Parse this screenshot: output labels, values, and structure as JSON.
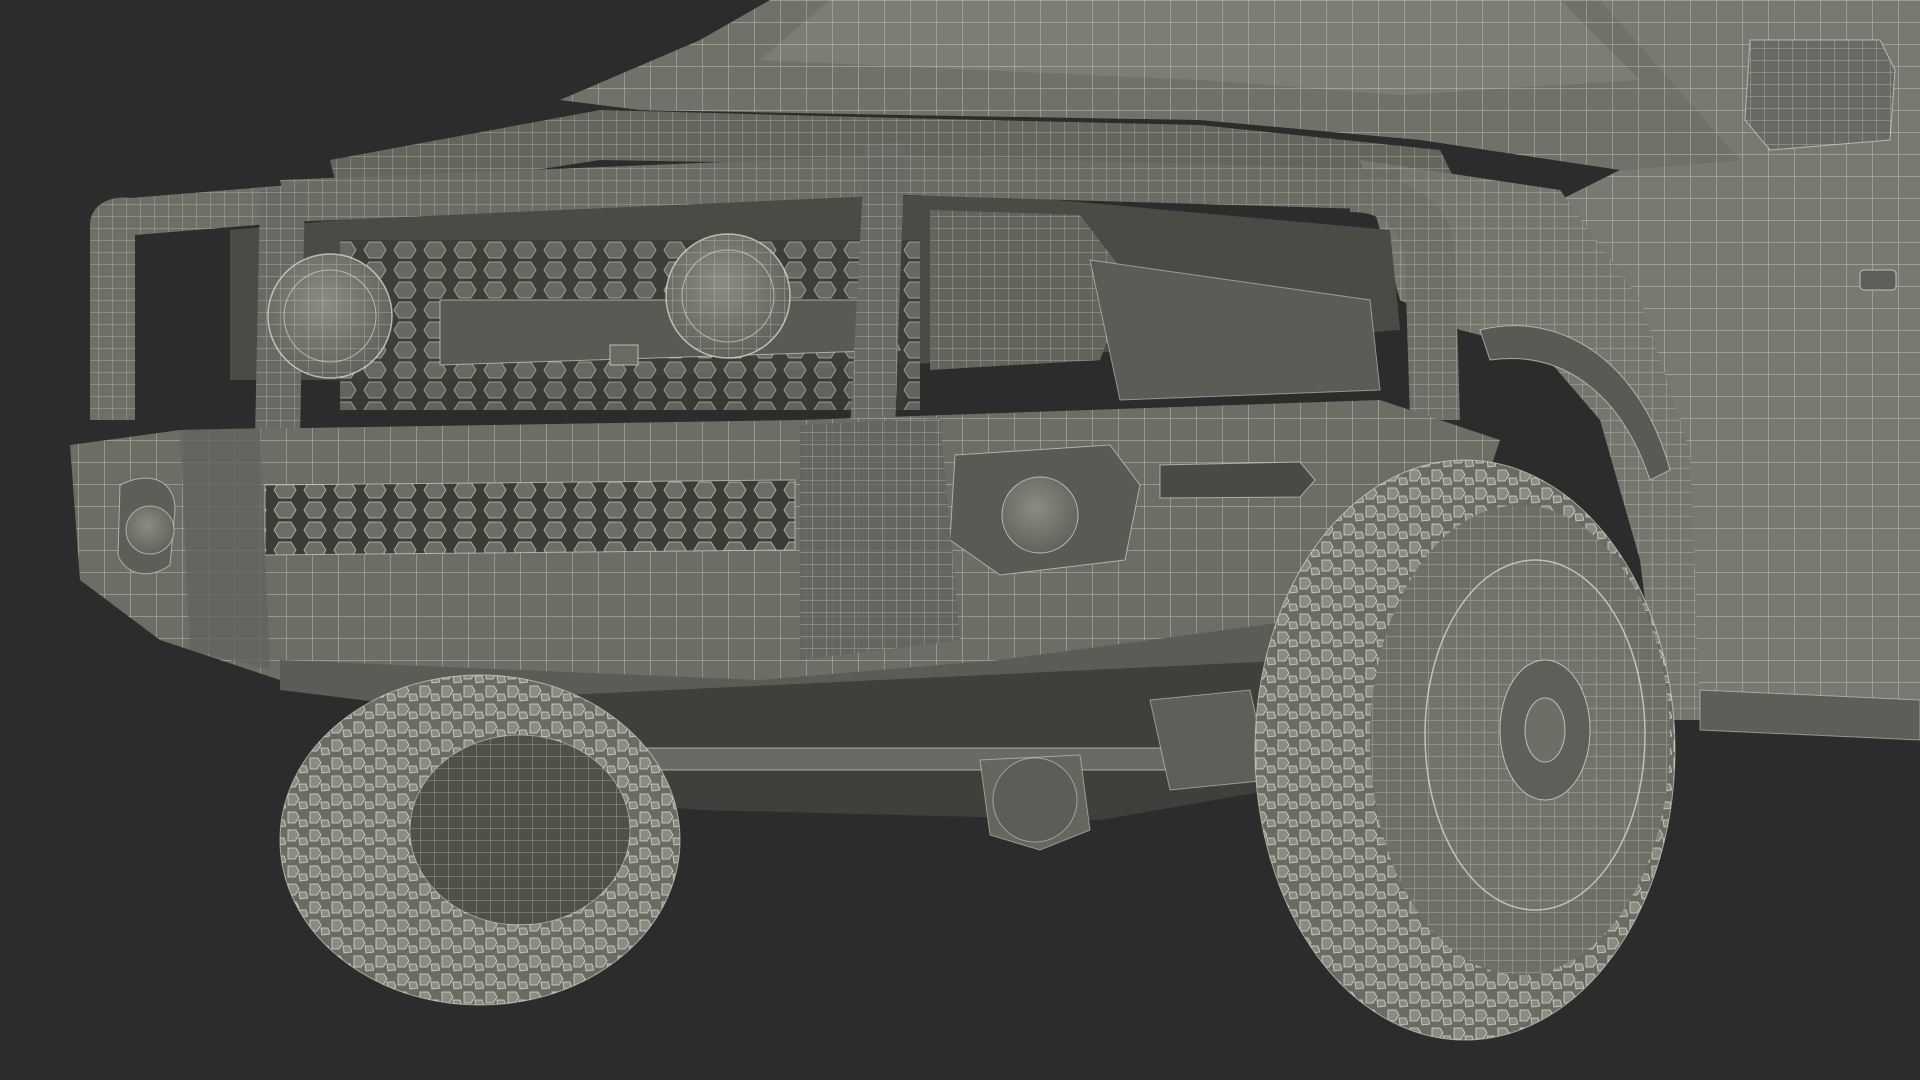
{
  "scene": {
    "subject": "wireframe-pickup-truck-front",
    "background_color": "#2c2c2c",
    "body_color": "#6f6e67",
    "body_shadow_color": "#55544e",
    "body_highlight_color": "#8a8980",
    "wire_color": "#e6e4d6",
    "tire_color": "#77766f"
  }
}
